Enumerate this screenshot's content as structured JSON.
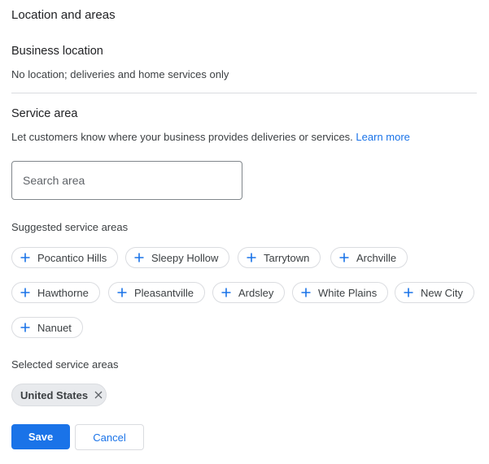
{
  "section": {
    "title": "Location and areas"
  },
  "business_location": {
    "title": "Business location",
    "value": "No location; deliveries and home services only"
  },
  "service_area": {
    "title": "Service area",
    "description": "Let customers know where your business provides deliveries or services.",
    "learn_more": "Learn more",
    "search_placeholder": "Search area",
    "suggested_label": "Suggested service areas",
    "suggested": [
      "Pocantico Hills",
      "Sleepy Hollow",
      "Tarrytown",
      "Archville",
      "Hawthorne",
      "Pleasantville",
      "Ardsley",
      "White Plains",
      "New City",
      "Nanuet"
    ],
    "selected_label": "Selected service areas",
    "selected": [
      "United States"
    ]
  },
  "actions": {
    "save": "Save",
    "cancel": "Cancel"
  },
  "colors": {
    "accent": "#1a73e8",
    "chip_border": "#dadce0",
    "selected_chip_bg": "#e8eaed"
  },
  "icons": {
    "add": "plus-icon",
    "remove": "close-icon"
  }
}
